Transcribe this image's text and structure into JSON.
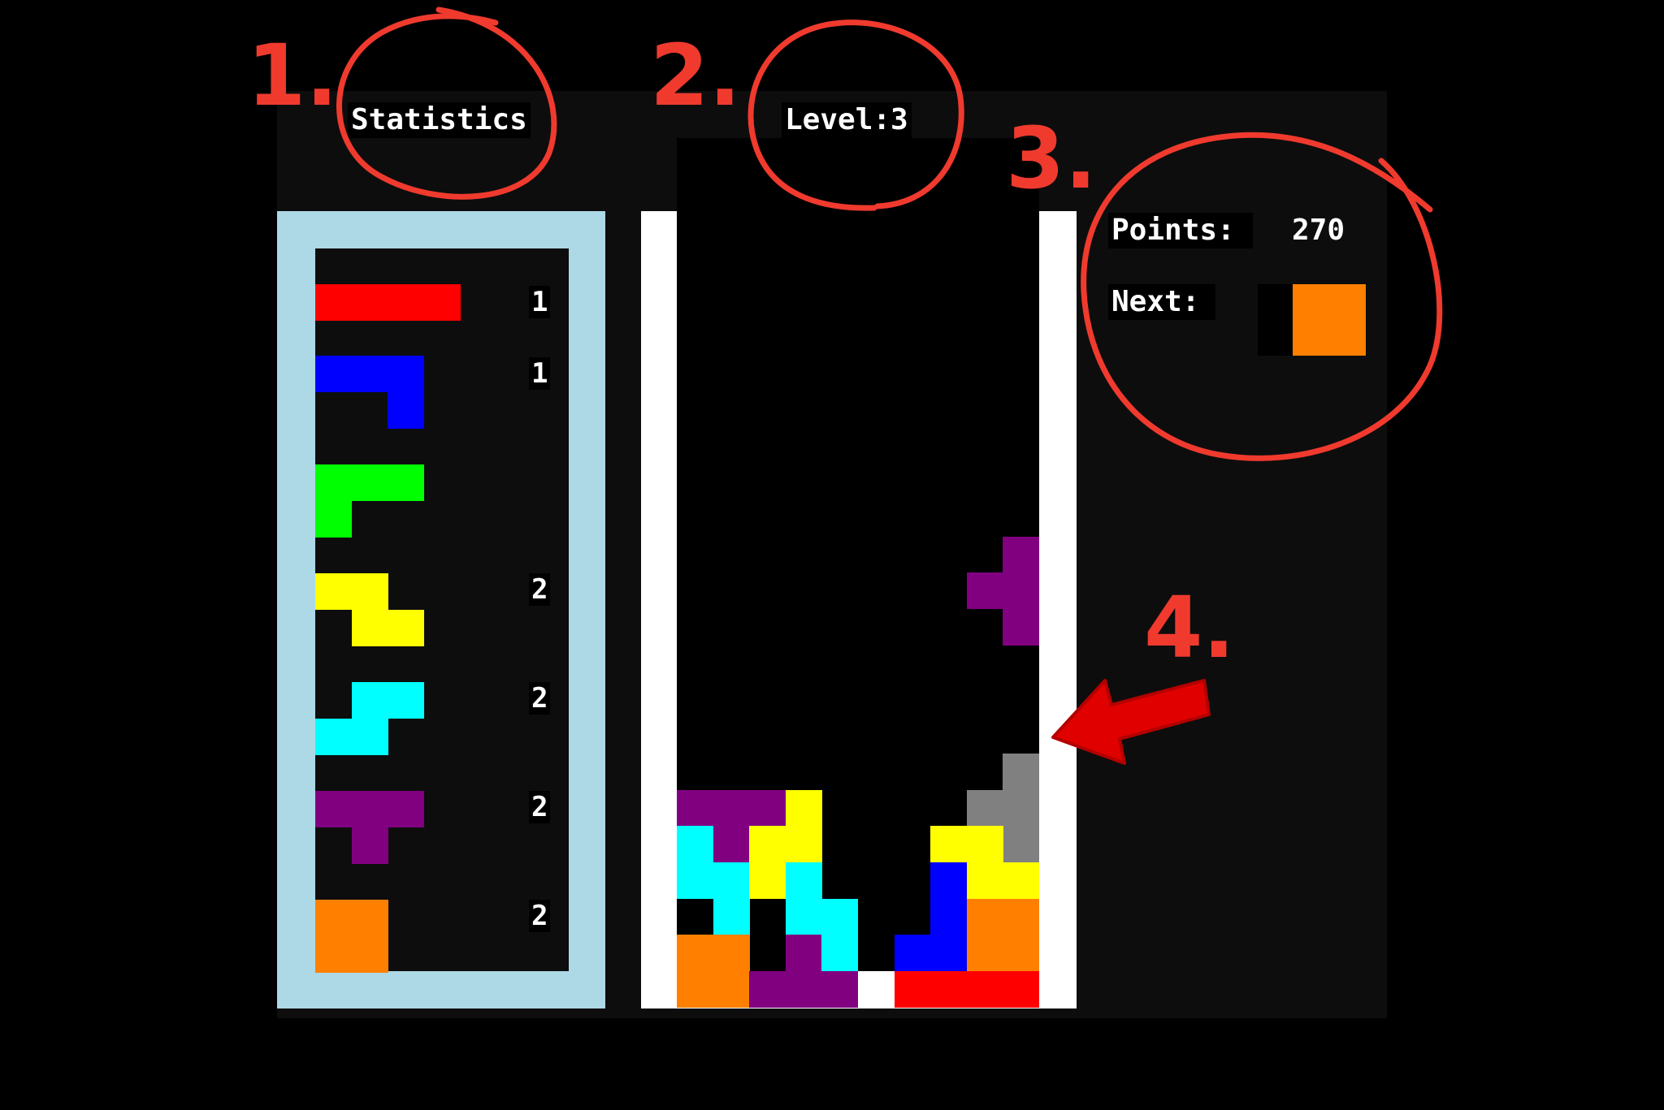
{
  "header": {
    "statistics_label": "Statistics",
    "level_label": "Level:3"
  },
  "side": {
    "points_label": "Points:",
    "points_value": "270",
    "next_label": "Next:",
    "next_piece_color": "#ff8000"
  },
  "statistics": {
    "counts": [
      "1",
      "1",
      "",
      "2",
      "2",
      "2",
      "2"
    ],
    "piece_colors": [
      "#ff0000",
      "#0000ff",
      "#00ff00",
      "#ffff00",
      "#00ffff",
      "#800080",
      "#ff8000"
    ]
  },
  "annotations": {
    "n1": "1.",
    "n2": "2.",
    "n3": "3.",
    "n4": "4.",
    "color": "#f03a2e"
  },
  "colors": {
    "stats_frame": "#add8e6",
    "well_frame": "#ffffff",
    "panel_bg": "#0d0d0d"
  }
}
